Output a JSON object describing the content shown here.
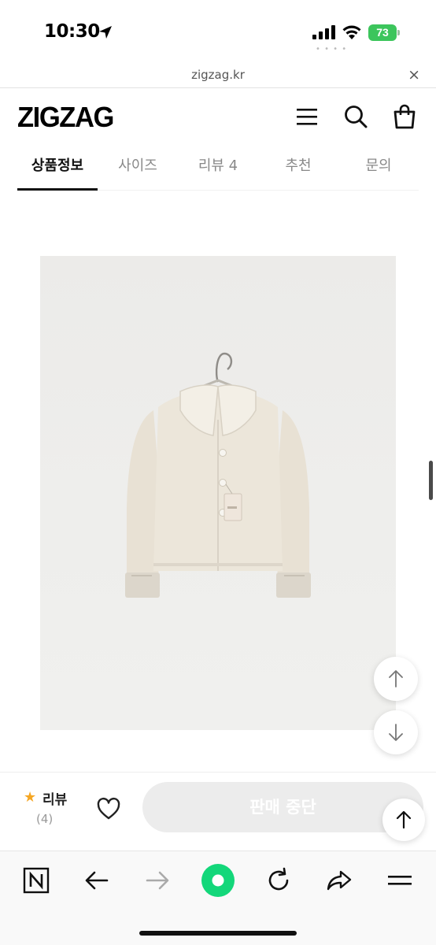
{
  "status_bar": {
    "time": "10:30",
    "battery": "73"
  },
  "url_bar": {
    "url": "zigzag.kr",
    "close": "×"
  },
  "header": {
    "logo": "ZIGZAG"
  },
  "tabs": [
    {
      "label": "상품정보",
      "active": true
    },
    {
      "label": "사이즈",
      "active": false
    },
    {
      "label": "리뷰 4",
      "active": false
    },
    {
      "label": "추천",
      "active": false
    },
    {
      "label": "문의",
      "active": false
    }
  ],
  "purchase_bar": {
    "review_label": "리뷰",
    "review_count": "(4)",
    "buy_button": "판매 중단"
  },
  "icons": {
    "location": "location-arrow-icon",
    "menu": "hamburger-menu-icon",
    "search": "search-icon",
    "cart": "shopping-bag-icon",
    "heart": "heart-icon",
    "star": "star-icon"
  },
  "colors": {
    "accent_green": "#13d77a",
    "star": "#f5a623",
    "battery": "#3cc55c"
  }
}
